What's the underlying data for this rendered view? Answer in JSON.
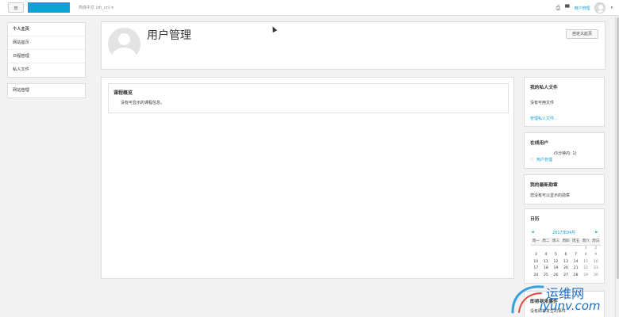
{
  "navbar": {
    "menu_icon": "≡",
    "language": "简体中文 (zh_cn) ▾",
    "user_name": "用户管理",
    "caret": "▾",
    "icons": [
      "print-icon",
      "message-icon"
    ]
  },
  "sidebar": {
    "nav_items": [
      {
        "label": "个人主页"
      },
      {
        "label": "网站首页"
      },
      {
        "label": "日程管理"
      },
      {
        "label": "私人文件"
      }
    ],
    "admin_items": [
      {
        "label": "网站管理"
      }
    ]
  },
  "header": {
    "title": "用户管理",
    "customize_button": "自定义此页"
  },
  "main": {
    "course_overview_title": "课程概览",
    "course_overview_empty": "没有可显示的课程信息。"
  },
  "blocks": {
    "private_files": {
      "title": "我的私人文件",
      "empty": "没有可用文件",
      "manage_link": "管理私人文件..."
    },
    "online_users": {
      "title": "在线用户",
      "summary": "(5分钟内: 1)",
      "user": "用户管理"
    },
    "badges": {
      "title": "我的最新勋章",
      "empty": "您没有可以显示的勋章"
    },
    "calendar": {
      "title": "日历",
      "prev": "◄",
      "next": "►",
      "month": "2017年04月",
      "weekdays": [
        "周一",
        "周二",
        "周三",
        "周四",
        "周五",
        "周六",
        "周日"
      ],
      "weeks": [
        [
          "",
          "",
          "",
          "",
          "",
          "1",
          "2"
        ],
        [
          "3",
          "4",
          "5",
          "6",
          "7",
          "8",
          "9"
        ],
        [
          "10",
          "11",
          "12",
          "13",
          "14",
          "15",
          "16"
        ],
        [
          "17",
          "18",
          "19",
          "20",
          "21",
          "22",
          "23"
        ],
        [
          "24",
          "25",
          "26",
          "27",
          "28",
          "29",
          "30"
        ]
      ]
    },
    "upcoming": {
      "title": "即将到来事件",
      "empty": "没有即将发生的事件"
    }
  },
  "watermark": {
    "cn": "运维网",
    "en": "iyunv.com"
  },
  "colors": {
    "brand": "#0ea5d6",
    "link": "#0ea5d6",
    "watermark": "#1a6fc9"
  }
}
